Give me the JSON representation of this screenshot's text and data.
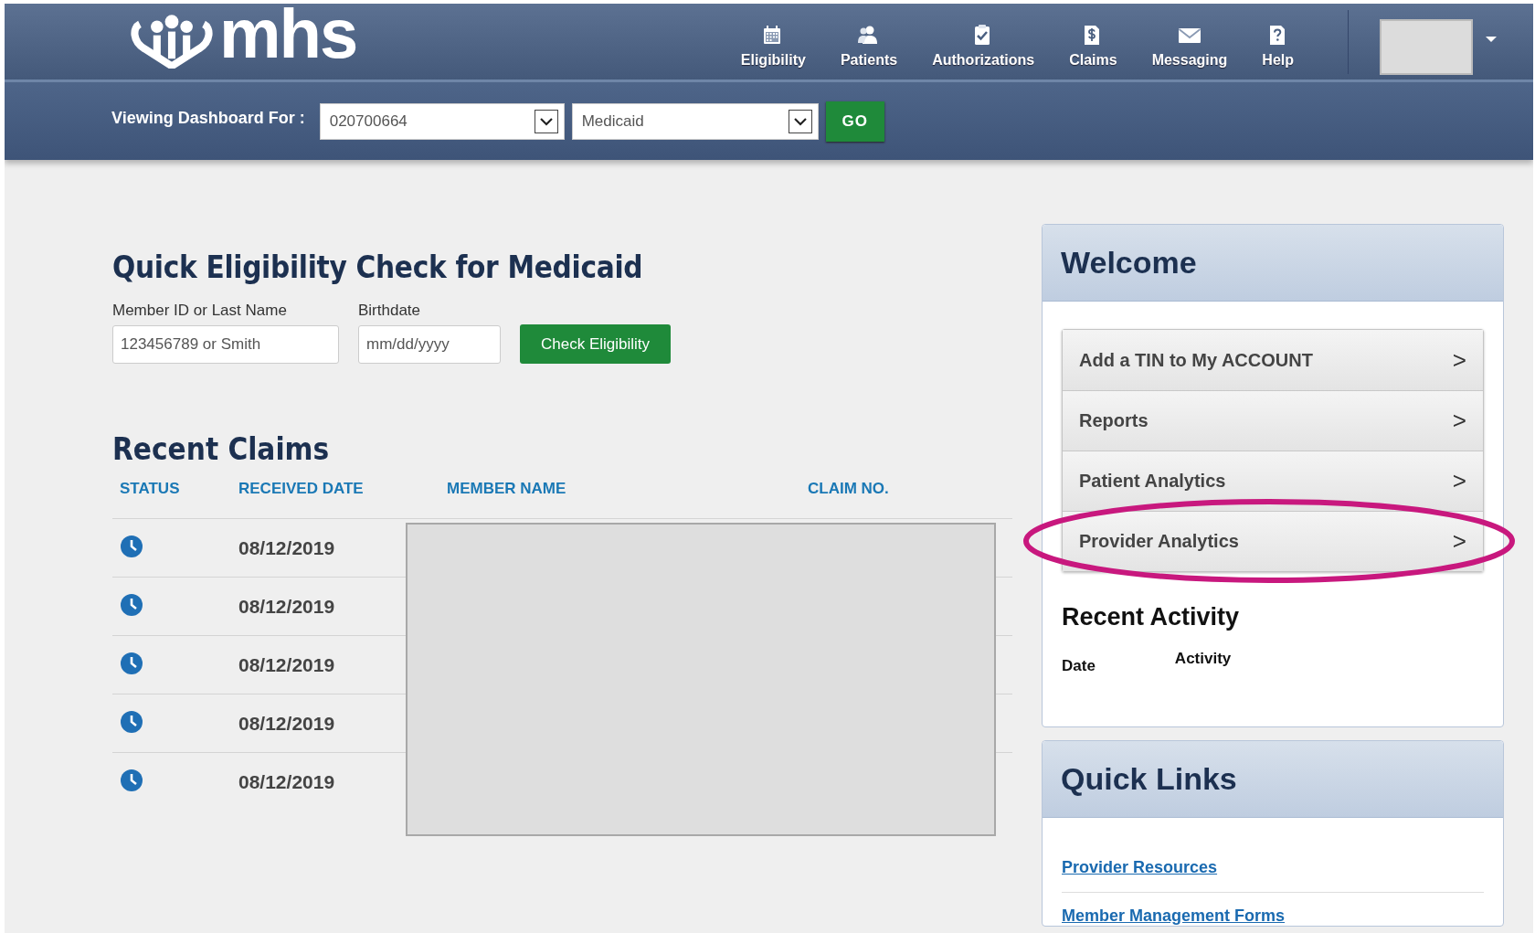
{
  "header": {
    "logo": "mhs",
    "nav": [
      {
        "label": "Eligibility"
      },
      {
        "label": "Patients"
      },
      {
        "label": "Authorizations"
      },
      {
        "label": "Claims"
      },
      {
        "label": "Messaging"
      },
      {
        "label": "Help"
      }
    ],
    "dashboard_label": "Viewing Dashboard For :",
    "tin_select": "020700664",
    "plan_select": "Medicaid",
    "go_button": "GO"
  },
  "eligibility": {
    "title": "Quick Eligibility Check for Medicaid",
    "member_label": "Member ID or Last Name",
    "member_placeholder": "123456789 or Smith",
    "birthdate_label": "Birthdate",
    "birthdate_placeholder": "mm/dd/yyyy",
    "button": "Check Eligibility"
  },
  "recent_claims": {
    "title": "Recent Claims",
    "redacted": true,
    "columns": [
      "STATUS",
      "RECEIVED DATE",
      "MEMBER NAME",
      "CLAIM NO."
    ],
    "rows": [
      {
        "received_date": "08/12/2019"
      },
      {
        "received_date": "08/12/2019"
      },
      {
        "received_date": "08/12/2019"
      },
      {
        "received_date": "08/12/2019"
      },
      {
        "received_date": "08/12/2019"
      }
    ]
  },
  "welcome": {
    "title": "Welcome",
    "menu": [
      {
        "label": "Add a TIN to My ACCOUNT",
        "arrow": ">",
        "highlighted": false
      },
      {
        "label": "Reports",
        "arrow": ">",
        "highlighted": false
      },
      {
        "label": "Patient Analytics",
        "arrow": ">",
        "highlighted": false
      },
      {
        "label": "Provider Analytics",
        "arrow": ">",
        "highlighted": true
      }
    ],
    "recent_activity": {
      "title": "Recent Activity",
      "columns": [
        "Date",
        "Activity"
      ]
    }
  },
  "quick_links": {
    "title": "Quick Links",
    "links": [
      "Provider Resources",
      "Member Management Forms"
    ]
  }
}
